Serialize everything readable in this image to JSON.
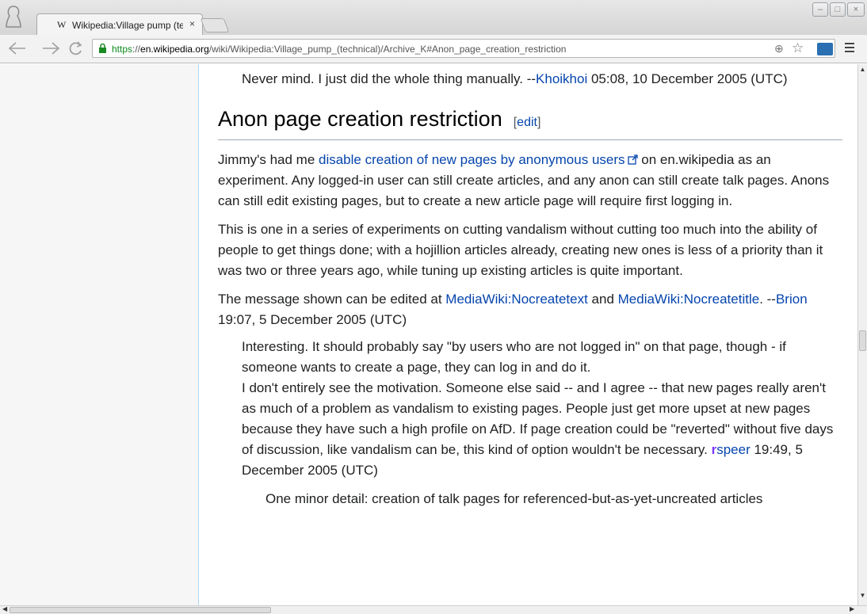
{
  "browser": {
    "tab_title": "Wikipedia:Village pump (te",
    "tab_favicon": "W",
    "tab_close": "×",
    "url_scheme": "https",
    "url_sep": "://",
    "url_host": "en.wikipedia.org",
    "url_path": "/wiki/Wikipedia:Village_pump_(technical)/Archive_K#Anon_page_creation_restriction",
    "icons": {
      "back": "back-icon",
      "forward": "forward-icon",
      "reload": "reload-icon",
      "lock": "lock-icon",
      "zoom": "zoom-icon",
      "star": "star-icon",
      "extension": "extension-icon",
      "menu": "menu-icon"
    }
  },
  "article": {
    "top_comment": {
      "text": "Never mind. I just did the whole thing manually. --",
      "user": "Khoikhoi",
      "timestamp": " 05:08, 10 December 2005 (UTC)"
    },
    "section": {
      "heading": "Anon page creation restriction",
      "edit_open": "[",
      "edit_label": "edit",
      "edit_close": "]"
    },
    "p1": {
      "before": "Jimmy's had me ",
      "link": "disable creation of new pages by anonymous users",
      "after": " on en.wikipedia as an experiment. Any logged-in user can still create articles, and any anon can still create talk pages. Anons can still edit existing pages, but to create a new article page will require first logging in."
    },
    "p2": "This is one in a series of experiments on cutting vandalism without cutting too much into the ability of people to get things done; with a hojillion articles already, creating new ones is less of a priority than it was two or three years ago, while tuning up existing articles is quite important.",
    "p3": {
      "before": "The message shown can be edited at ",
      "link1": "MediaWiki:Nocreatetext",
      "and": " and ",
      "link2": "MediaWiki:Nocreatetitle",
      "dash": ". --",
      "user": "Brion",
      "timestamp": " 19:07, 5 December 2005 (UTC)"
    },
    "reply1": "Interesting. It should probably say \"by users who are not logged in\" on that page, though - if someone wants to create a page, they can log in and do it.",
    "reply2": {
      "text": "I don't entirely see the motivation. Someone else said -- and I agree -- that new pages really aren't as much of a problem as vandalism to existing pages. People just get more upset at new pages because they have such a high profile on AfD. If page creation could be \"reverted\" without five days of discussion, like vandalism can be, this kind of option wouldn't be necessary. ",
      "sig_r": "r",
      "sig_speer": "speer",
      "timestamp": " 19:49, 5 December 2005 (UTC)"
    },
    "reply3": "One minor detail: creation of talk pages for referenced-but-as-yet-uncreated articles"
  },
  "colors": {
    "link": "#0645ad",
    "text": "#202122",
    "secure_scheme": "#0d8a1c"
  }
}
